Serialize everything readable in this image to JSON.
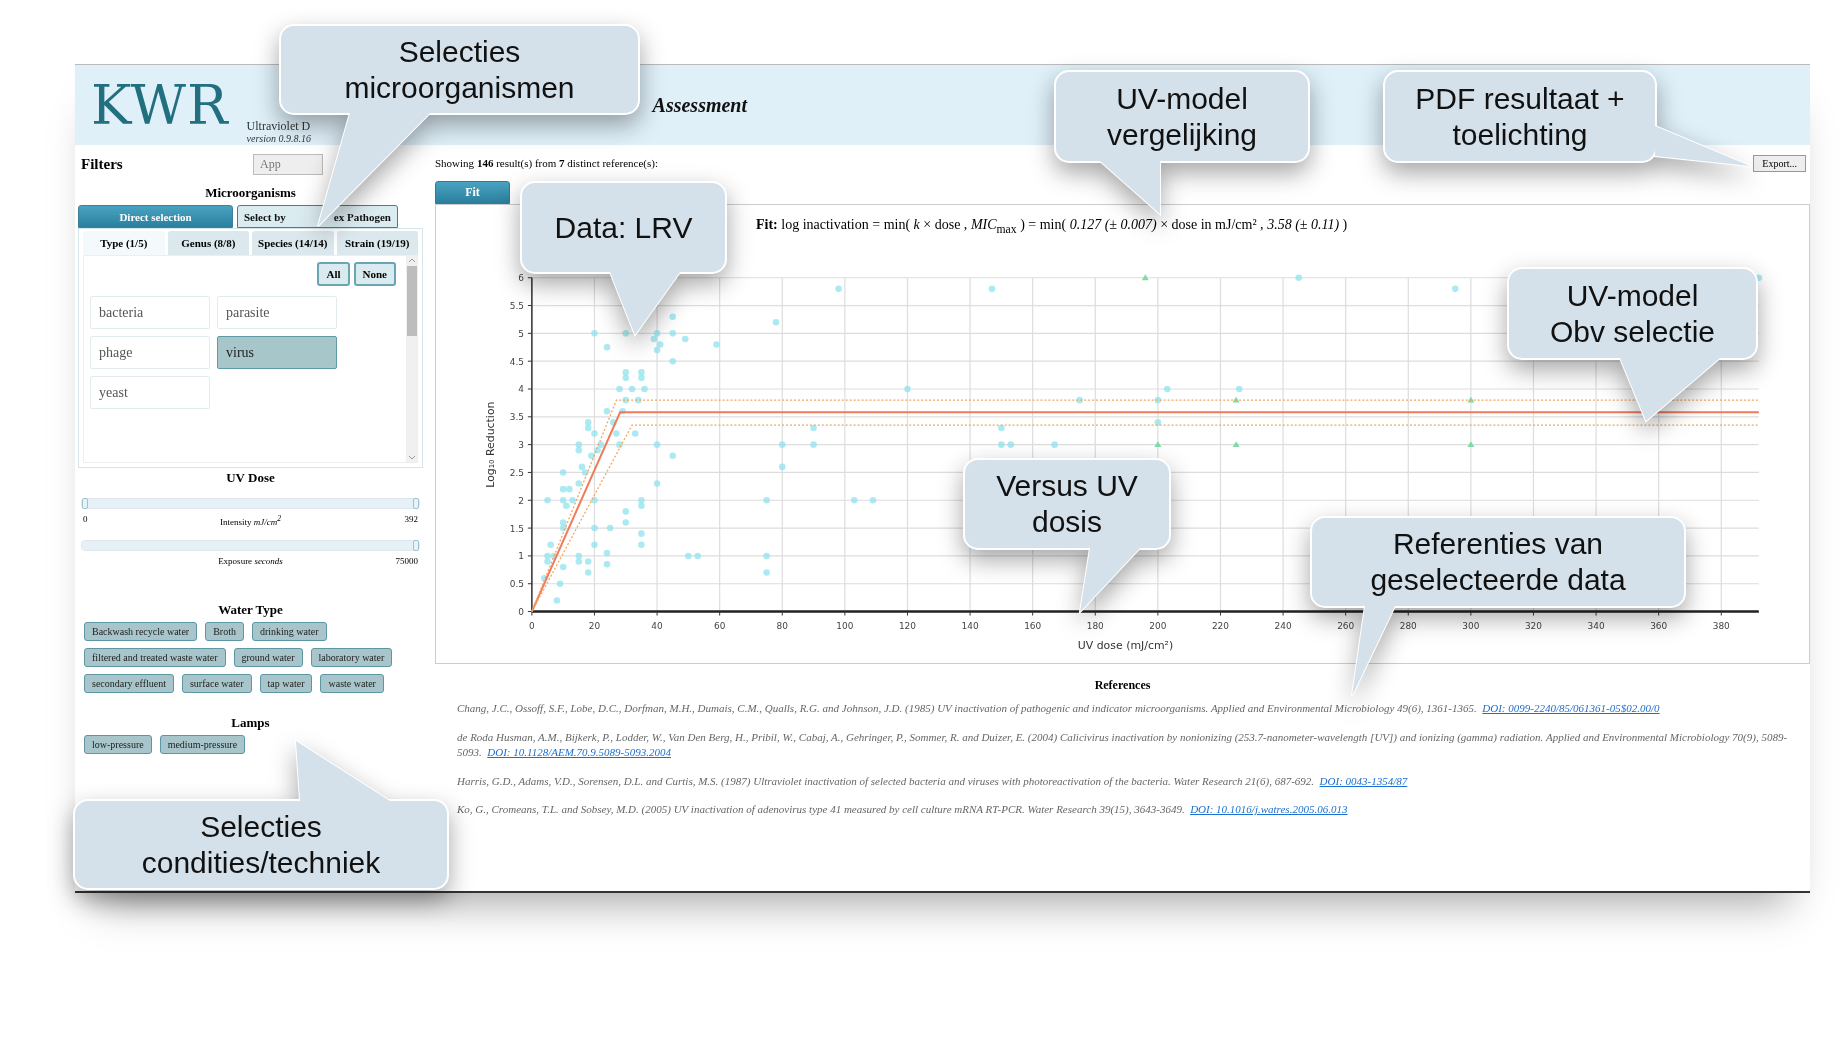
{
  "header": {
    "logo": "KWR",
    "subtitle": "Ultraviolet D",
    "version": "version 0.9.8.16",
    "title_end": "Assessment"
  },
  "filters": {
    "title": "Filters",
    "apply_button": "App",
    "microorganisms": {
      "heading": "Microorganisms",
      "mode_tabs": [
        {
          "label": "Direct selection",
          "selected": true
        },
        {
          "label": "Select by",
          "label_end": "ex Pathogen",
          "selected": false
        }
      ],
      "level_tabs": [
        {
          "label": "Type (1/5)",
          "selected": true
        },
        {
          "label": "Genus (8/8)",
          "selected": false
        },
        {
          "label": "Species (14/14)",
          "selected": false
        },
        {
          "label": "Strain (19/19)",
          "selected": false
        }
      ],
      "buttons": [
        "All",
        "None"
      ],
      "items": [
        {
          "label": "bacteria",
          "selected": false
        },
        {
          "label": "parasite",
          "selected": false
        },
        {
          "label": "phage",
          "selected": false
        },
        {
          "label": "virus",
          "selected": true
        },
        {
          "label": "yeast",
          "selected": false
        }
      ]
    },
    "uv_dose": {
      "heading": "UV Dose",
      "sliders": [
        {
          "label": "Intensity *mJ/cm$^{2}$*",
          "min": "0",
          "max": "392",
          "level": 1
        },
        {
          "label": "Exposure *seconds*",
          "max": "75000",
          "level": 1
        }
      ]
    },
    "water_type": {
      "heading": "Water Type",
      "chips": [
        {
          "label": "Backwash recycle water",
          "selected": true
        },
        {
          "label": "Broth",
          "selected": true
        },
        {
          "label": "drinking water",
          "selected": true
        },
        {
          "label": "filtered and treated waste water",
          "selected": true
        },
        {
          "label": "ground water",
          "selected": true
        },
        {
          "label": "laboratory water",
          "selected": true
        },
        {
          "label": "secondary effluent",
          "selected": true
        },
        {
          "label": "surface water",
          "selected": true
        },
        {
          "label": "tap water",
          "selected": true
        },
        {
          "label": "waste water",
          "selected": true
        }
      ]
    },
    "lamps": {
      "heading": "Lamps",
      "chips": [
        {
          "label": "low-pressure",
          "selected": true
        },
        {
          "label": "medium-pressure",
          "selected": true
        }
      ]
    }
  },
  "results": {
    "summary": "Showing **146** result(s) from **7** distinct reference(s):",
    "export_button": "Export...",
    "tabs": [
      {
        "label": "Fit",
        "selected": true
      }
    ],
    "formula": "**Fit:** log inactivation = min( *k* × dose , *MIC*$_{max}$ ) =  min( *0.127 (± 0.007)* × dose in mJ/cm² , *3.58 (± 0.11)* )",
    "chart_data": {
      "type": "scatter",
      "grid": true,
      "xlabel": "UV dose (mJ/cm²)",
      "ylabel": "Log₁₀ Reduction",
      "xlim": [
        0,
        392
      ],
      "ylim": [
        0,
        6
      ],
      "xticks": [
        0,
        20,
        40,
        60,
        80,
        100,
        120,
        140,
        160,
        180,
        200,
        220,
        240,
        260,
        280,
        300,
        320,
        340,
        360,
        380
      ],
      "yticks": [
        0,
        0.5,
        1,
        1.5,
        2,
        2.5,
        3,
        3.5,
        4,
        4.5,
        5,
        5.5,
        6
      ],
      "series": [
        {
          "type": "scatter",
          "marker": "circle",
          "color": "#8fe3ee",
          "x": [
            5,
            5,
            5,
            6,
            4,
            7,
            8,
            9,
            10,
            10,
            10,
            10,
            10,
            10,
            11,
            12,
            13,
            15,
            15,
            15,
            15,
            15,
            16,
            17,
            18,
            18,
            18,
            18,
            19,
            20,
            20,
            20,
            20,
            20,
            21,
            22,
            24,
            24,
            24,
            24,
            25,
            26,
            27,
            28,
            28,
            29,
            30,
            30,
            30,
            30,
            30,
            30,
            32,
            33,
            34,
            35,
            35,
            35,
            35,
            35,
            35,
            36,
            39,
            40,
            40,
            40,
            40,
            41,
            45,
            45,
            45,
            45,
            49,
            50,
            53,
            59,
            75,
            75,
            75,
            78,
            80,
            80,
            90,
            90,
            98,
            103,
            109,
            120,
            147,
            150,
            150,
            153,
            167,
            175,
            200,
            200,
            203,
            226,
            245,
            295,
            392
          ],
          "values": [
            2,
            1,
            0.9,
            1.2,
            0.6,
            1,
            0.2,
            0.5,
            0.8,
            1.5,
            1.6,
            2,
            2.2,
            2.5,
            1.9,
            2.2,
            2,
            3,
            2.9,
            2.3,
            1,
            0.9,
            2.6,
            2.5,
            3.4,
            3.3,
            0.9,
            0.7,
            2.8,
            5,
            2,
            1.5,
            1.2,
            3.2,
            2.9,
            3,
            4.75,
            3.6,
            1.05,
            0.85,
            1.5,
            3.4,
            3.2,
            3,
            4,
            3.6,
            4.3,
            4.2,
            5,
            3.8,
            1.8,
            1.6,
            4,
            3.2,
            3.8,
            4.3,
            4.2,
            2,
            1.9,
            1.4,
            1.2,
            4,
            4.9,
            5,
            4.7,
            3,
            2.3,
            4.8,
            5.3,
            5,
            4.5,
            2.8,
            4.9,
            1,
            1,
            4.8,
            2,
            1,
            0.7,
            5.2,
            3,
            2.6,
            3.3,
            3,
            5.8,
            2,
            2,
            4,
            5.8,
            3.3,
            3,
            3,
            3,
            3.8,
            3.8,
            3.4,
            4,
            4,
            6,
            5.8,
            6
          ]
        },
        {
          "type": "scatter",
          "marker": "triangle",
          "color": "#7ddca4",
          "x": [
            196,
            200,
            225,
            225,
            300,
            300
          ],
          "values": [
            6,
            3,
            3.8,
            3,
            3.8,
            3
          ]
        },
        {
          "type": "line",
          "line_style": "solid",
          "color": "#ee7b5c",
          "x": [
            0,
            28.2,
            392
          ],
          "values": [
            0,
            3.58,
            3.58
          ]
        },
        {
          "type": "line",
          "line_style": "dotted",
          "color": "#f4a45a",
          "x": [
            0,
            27,
            392
          ],
          "values": [
            0,
            3.8,
            3.8
          ]
        },
        {
          "type": "line",
          "line_style": "dotted",
          "color": "#f4a45a",
          "x": [
            0,
            32,
            392
          ],
          "values": [
            0,
            3.35,
            3.35
          ]
        }
      ]
    }
  },
  "references": {
    "heading": "References",
    "items": [
      {
        "text": "Chang, J.C., Ossoff, S.F., Lobe, D.C., Dorfman, M.H., Dumais, C.M., Qualls, R.G. and Johnson, J.D. (1985) UV inactivation of pathogenic and indicator microorganisms. Applied and Environmental Microbiology 49(6), 1361-1365.",
        "doi": "DOI: 0099-2240/85/061361-05$02.00/0"
      },
      {
        "text": "de Roda Husman, A.M., Bijkerk, P., Lodder, W., Van Den Berg, H., Pribil, W., Cabaj, A., Gehringer, P., Sommer, R. and Duizer, E. (2004) Calicivirus inactivation by nonionizing (253.7-nanometer-wavelength [UV]) and ionizing (gamma) radiation. Applied and Environmental Microbiology 70(9), 5089-5093.",
        "doi": "DOI: 10.1128/AEM.70.9.5089-5093.2004"
      },
      {
        "text": "Harris, G.D., Adams, V.D., Sorensen, D.L. and Curtis, M.S. (1987) Ultraviolet inactivation of selected bacteria and viruses with photoreactivation of the bacteria. Water Research 21(6), 687-692.",
        "doi": "DOI: 0043-1354/87"
      },
      {
        "text": "Ko, G., Cromeans, T.L. and Sobsey, M.D. (2005) UV inactivation of adenovirus type 41 measured by cell culture mRNA RT-PCR. Water Research 39(15), 3643-3649.",
        "doi": "DOI: 10.1016/j.watres.2005.06.013"
      }
    ]
  },
  "callouts": [
    {
      "text": "Selecties\nmicroorganismen"
    },
    {
      "text": "Data: LRV"
    },
    {
      "text": "UV-model\nvergelijking"
    },
    {
      "text": "PDF resultaat +\ntoelichting"
    },
    {
      "text": "UV-model\nObv selectie"
    },
    {
      "text": "Versus UV\ndosis"
    },
    {
      "text": "Referenties van\ngeselecteerde data"
    },
    {
      "text": "Selecties\ncondities/techniek"
    }
  ]
}
